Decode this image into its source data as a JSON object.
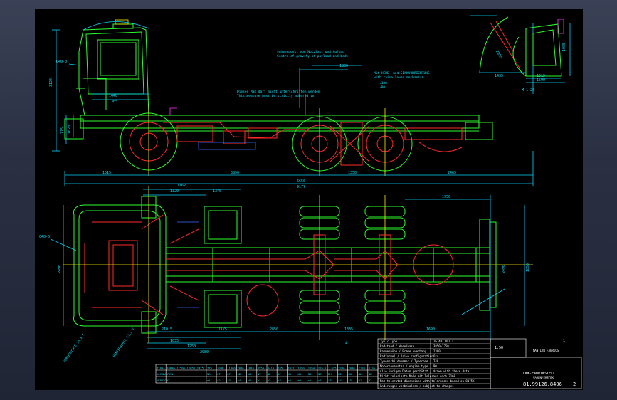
{
  "drawing": {
    "side_view": {
      "notes": {
        "center_of_gravity_de": "Schwerpunkt von Nutzlast und Aufbau",
        "center_of_gravity_en": "Centre of gravity of payload and body",
        "dimension_de": "Dieses Maß darf nicht unterschritten werden",
        "dimension_en": "This measure must be strictly adhered to",
        "raise_lower_de": "Mit HEBE- und SENKVORRICHTUNG",
        "raise_lower_en": "with raise lower mechanism",
        "raise_value": "+100",
        "lower_value": "-80",
        "cab_label": "C40-0"
      },
      "dimensions": {
        "front_overhang": "1515",
        "wheelbase_1": "3850",
        "wheelbase_2": "1350",
        "rear_overhang": "2465",
        "total_inner": "6650",
        "total_length": "9177",
        "cab_height": "3124",
        "cab_top_a": "1440",
        "cab_top_b": "1365",
        "cg_offset": "1830",
        "frame_height": "775",
        "frame_height_b": "1020"
      }
    },
    "detail_view": {
      "dim_a": "1435",
      "dim_b": "1515",
      "dim_c": "1590",
      "dim_d": "1085",
      "dim_e": "2015",
      "scale_note": "M 1:20"
    },
    "top_view": {
      "cab_label": "C40-0",
      "dims_top": [
        "1162",
        "1320",
        "1370"
      ],
      "dim_right": "1950",
      "dim_right_b": "1855",
      "dims_bottom": [
        "210.5",
        "1035",
        "1250",
        "2980",
        "1175",
        "2850",
        "1335",
        "1690"
      ],
      "width_front": "2490",
      "width_rear": "2490",
      "ground_clearance_a": "VORDERACHSE 23,5 T",
      "ground_clearance_b": "HINTERACHSE 17,5 T",
      "zone_marker": "A"
    },
    "title_block": {
      "rows": [
        {
          "label": "Typ / Type",
          "value": "26.403 DFL C"
        },
        {
          "label": "Radstand / Wheelbase",
          "value": "3850+1350"
        },
        {
          "label": "Rahmenhöhe / Frame overhang",
          "value": "2300"
        },
        {
          "label": "Radformel / Drive configuration",
          "value": "6x4"
        },
        {
          "label": "Typenschildnummer / Typecode",
          "value": "T48"
        },
        {
          "label": "Motorbaumuster / engine type",
          "value": "90"
        },
        {
          "label": "Alle übrigen Daten geschützt / drawn with these data",
          "value": ""
        },
        {
          "label": "Nicht tolerierte Maße mit Toleranz nach 7168",
          "value": ""
        },
        {
          "label": "Not tolerated dimensions with tolerances based on 8175X",
          "value": ""
        },
        {
          "label": "Änderungen vorbehalten / subject to changes",
          "value": ""
        }
      ],
      "manufacturer": "MAN-LKW FABRICS",
      "company": "LKW-FABRIKSTELL",
      "city": "VAREN/EMSTEK",
      "scale": "1:50",
      "drawing_number": "81.99126.8406",
      "sheet": "2",
      "revision": "1"
    },
    "param_table": {
      "header": [
        "7200",
        "10800",
        "11500",
        "12650",
        "2425",
        "775",
        "1096",
        "11300",
        "2050",
        "1824",
        "1954",
        "1410",
        "535",
        "1937",
        "1150",
        "1194",
        "225,5",
        "2,625",
        "2290",
        "2090",
        "2120",
        "1135"
      ],
      "row2": [
        "HOCHBAUTEN",
        "",
        "",
        "",
        "",
        "NR",
        "OT",
        "OF",
        "OD",
        "OG",
        "NT",
        "NE",
        "NF",
        "NG",
        "NA",
        "NB",
        "NC",
        "NH",
        "NI",
        "NK",
        "NL",
        "NM"
      ],
      "row3": [
        "VERDICHT",
        "",
        "",
        "",
        "",
        "a1",
        "a2",
        "a3",
        "a4",
        "a5",
        "b1",
        "b2",
        "b3",
        "b4",
        "b5",
        "c1",
        "c2",
        "c3",
        "c4",
        "c5",
        "d1",
        "d2"
      ]
    }
  },
  "colors": {
    "background": "#000000",
    "frame": "#2a3042",
    "outline": "#2bff2b",
    "detail": "#ff2a2a",
    "dimension": "#00d5ff",
    "text": "#ffffff",
    "centerline": "#ffee00"
  }
}
